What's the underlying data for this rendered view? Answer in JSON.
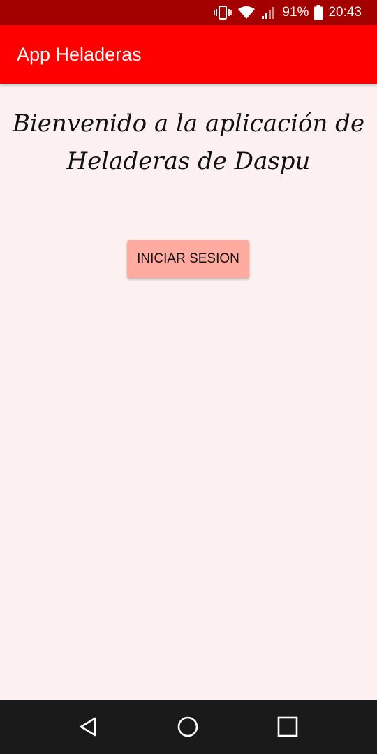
{
  "status_bar": {
    "icons": [
      "vibrate-icon",
      "wifi-icon",
      "signal-icon",
      "battery-icon"
    ],
    "battery": "91%",
    "time": "20:43"
  },
  "app_bar": {
    "title": "App Heladeras"
  },
  "main": {
    "welcome_line1": "Bienvenido a la aplicación de",
    "welcome_line2": "Heladeras de Daspu",
    "login_button": "INICIAR SESION"
  },
  "nav_bar": {
    "icons": [
      "back-icon",
      "home-icon",
      "recents-icon"
    ]
  },
  "colors": {
    "status_bar": "#a30000",
    "app_bar": "#ff0000",
    "background": "#fdf0f0",
    "button": "#ffaba0",
    "nav_bar": "#1a1a1a"
  }
}
